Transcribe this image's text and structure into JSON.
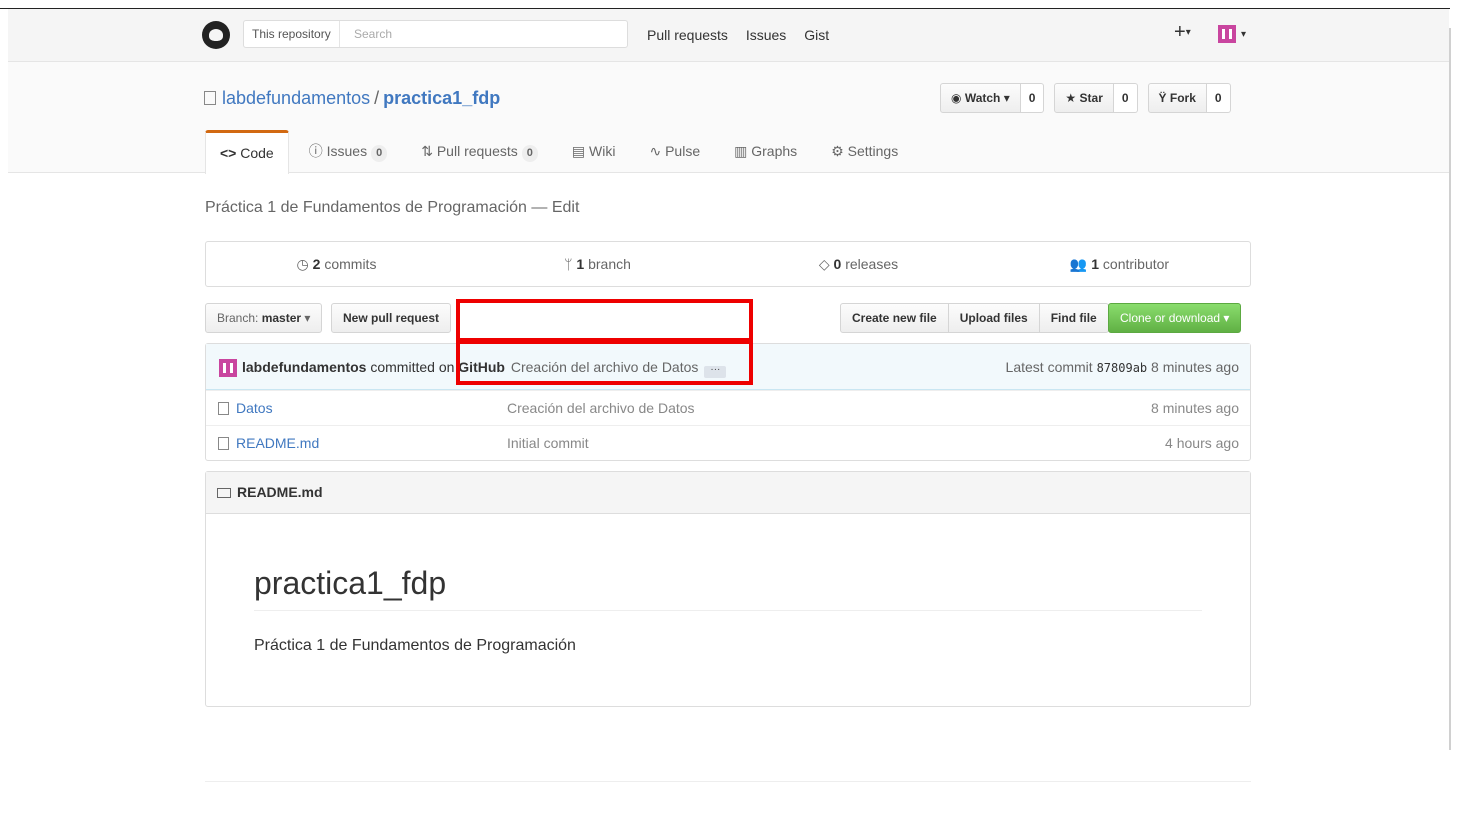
{
  "header": {
    "scope_label": "This repository",
    "search_placeholder": "Search",
    "nav": [
      "Pull requests",
      "Issues",
      "Gist"
    ],
    "plus_label": "+",
    "caret": "▾"
  },
  "repo": {
    "owner": "labdefundamentos",
    "separator": "/",
    "name": "practica1_fdp",
    "watch_label": "Watch ▾",
    "watch_count": "0",
    "star_label": "Star",
    "star_count": "0",
    "fork_label": "Fork",
    "fork_count": "0"
  },
  "tabs": [
    {
      "icon": "<>",
      "label": "Code",
      "count": ""
    },
    {
      "icon": "ⓘ",
      "label": "Issues",
      "count": "0"
    },
    {
      "icon": "⇅",
      "label": "Pull requests",
      "count": "0"
    },
    {
      "icon": "▤",
      "label": "Wiki",
      "count": ""
    },
    {
      "icon": "∿",
      "label": "Pulse",
      "count": ""
    },
    {
      "icon": "▥",
      "label": "Graphs",
      "count": ""
    },
    {
      "icon": "⚙",
      "label": "Settings",
      "count": ""
    }
  ],
  "description": "Práctica 1 de Fundamentos de Programación — Edit",
  "summary": {
    "commits_num": "2",
    "commits_label": "commits",
    "branch_num": "1",
    "branch_label": "branch",
    "releases_num": "0",
    "releases_label": "releases",
    "contributor_num": "1",
    "contributor_label": "contributor"
  },
  "filenav": {
    "branch_prefix": "Branch:",
    "branch_name": "master",
    "new_pr": "New pull request",
    "create_file": "Create new file",
    "upload": "Upload files",
    "find": "Find file",
    "clone": "Clone or download ▾"
  },
  "commit": {
    "author": "labdefundamentos",
    "committed_on": "committed on",
    "platform": "GitHub",
    "message": "Creación del archivo de Datos",
    "ellipsis": "···",
    "latest_label": "Latest commit",
    "sha": "87809ab",
    "age": "8 minutes ago"
  },
  "files": [
    {
      "name": "Datos",
      "message": "Creación del archivo de Datos",
      "age": "8 minutes ago"
    },
    {
      "name": "README.md",
      "message": "Initial commit",
      "age": "4 hours ago"
    }
  ],
  "readme": {
    "header": "README.md",
    "title": "practica1_fdp",
    "text": "Práctica 1 de Fundamentos de Programación"
  },
  "colors": {
    "highlight": "#e00000",
    "link": "#4078c0",
    "clone_button": "#60b044",
    "selected_tab_accent": "#d26911"
  }
}
